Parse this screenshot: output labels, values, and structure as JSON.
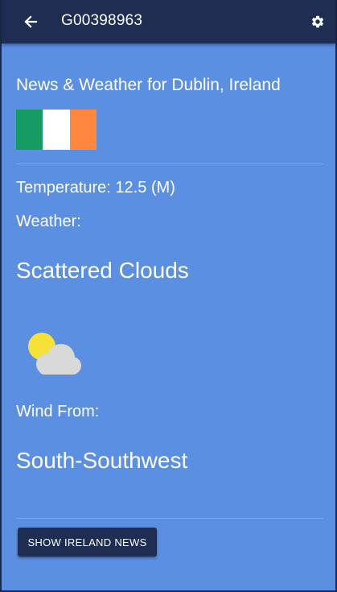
{
  "appbar": {
    "title": "G00398963",
    "back_icon": "arrow-left-icon",
    "settings_icon": "gear-icon"
  },
  "main": {
    "heading": "News & Weather for Dublin, Ireland",
    "flag": {
      "country": "Ireland",
      "colors": [
        "#169b62",
        "#ffffff",
        "#ff883e"
      ]
    },
    "temperature_text": "Temperature: 12.5 (M)",
    "weather_label": "Weather:",
    "weather_value": "Scattered Clouds",
    "weather_icon": "sun-behind-cloud-icon",
    "wind_label": "Wind From:",
    "wind_value": "South-Southwest",
    "news_button_label": "SHOW IRELAND NEWS"
  },
  "colors": {
    "appbar": "#1f2d52",
    "background": "#5a8fe2",
    "button": "#1f2d52",
    "text": "#ffffff"
  }
}
